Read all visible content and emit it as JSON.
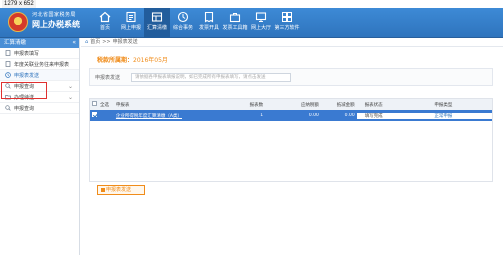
{
  "screenshot_label": "1279 x 652",
  "header": {
    "org_line": "河北省国家税务局",
    "system_name": "网上办税系统",
    "nav": [
      {
        "label": "首页",
        "icon": "home-icon"
      },
      {
        "label": "网上申报",
        "icon": "declare-icon"
      },
      {
        "label": "汇算清缴",
        "icon": "settlement-icon",
        "active": true
      },
      {
        "label": "综合事务",
        "icon": "tasks-icon"
      },
      {
        "label": "发票开具",
        "icon": "invoice-icon"
      },
      {
        "label": "发票工具箱",
        "icon": "toolbox-icon"
      },
      {
        "label": "网上大厅",
        "icon": "hall-icon"
      },
      {
        "label": "第三方软件",
        "icon": "software-icon"
      }
    ]
  },
  "sidebar": {
    "title": "汇算清缴",
    "items": [
      {
        "label": "申报表填写",
        "icon": "doc-icon",
        "arrow": false
      },
      {
        "label": "年度关联业务往来申报表",
        "icon": "doc-icon",
        "arrow": false
      },
      {
        "label": "申报表发送",
        "icon": "clock-icon",
        "arrow": false,
        "selected": true
      },
      {
        "label": "申报查询",
        "icon": "search-icon",
        "arrow": true
      },
      {
        "label": "办理待送",
        "icon": "folder-icon",
        "arrow": true
      },
      {
        "label": "申报查询",
        "icon": "search-icon",
        "arrow": false
      }
    ]
  },
  "breadcrumb": {
    "home": "首页",
    "sep": ">>",
    "current": "申报表发送"
  },
  "period": {
    "label": "税款所属期：",
    "value": "2016年05月"
  },
  "form": {
    "label": "申报表发送",
    "placeholder": "请依据各申报表填报说明，如已完成所有申报表填写，请点击发送"
  },
  "table": {
    "headers": [
      "",
      "全选",
      "申报表",
      "报表数",
      "应纳税额",
      "抵减金额",
      "报表状态",
      "申报类型"
    ],
    "rows": [
      {
        "name": "企业所得税年度汇算清缴（A类）",
        "count": "1",
        "tax": "0.00",
        "offset": "0.00",
        "status": "填写完成",
        "type": "正常申报"
      }
    ]
  },
  "send_button": "申报表发送",
  "colors": {
    "primary": "#2f74bd",
    "accent": "#f08c1a",
    "highlight": "#e03030"
  }
}
